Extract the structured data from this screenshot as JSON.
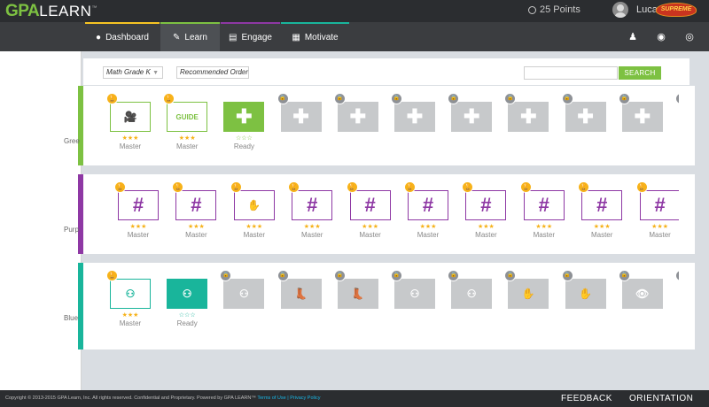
{
  "header": {
    "logo_gpa": "GPA",
    "logo_learn": "LEARN",
    "logo_tm": "™",
    "points": "25 Points",
    "username": "Lucas",
    "badge_text": "SUPREME"
  },
  "nav": {
    "tabs": [
      {
        "label": "Dashboard",
        "icon": "person-icon",
        "accent": "#f6c423"
      },
      {
        "label": "Learn",
        "icon": "pencil-icon",
        "accent": "#7dc142"
      },
      {
        "label": "Engage",
        "icon": "chat-icon",
        "accent": "#8e38a4"
      },
      {
        "label": "Motivate",
        "icon": "grid-icon",
        "accent": "#19b59b"
      }
    ],
    "right_icons": [
      "users-icon",
      "chat-bubble-icon",
      "globe-icon"
    ]
  },
  "filters": {
    "grade": "Math Grade K",
    "order": "Recommended Order",
    "search_placeholder": "",
    "search_label": "SEARCH"
  },
  "rows": [
    {
      "label": "Gree",
      "color": "#7dc142",
      "tiles": [
        {
          "glyph": "🎥",
          "style": "outline-green",
          "badge": "trophy",
          "stars": "★★★",
          "status": "Master"
        },
        {
          "glyph": "GUIDE",
          "style": "outline-green",
          "badge": "trophy",
          "stars": "★★★",
          "status": "Master"
        },
        {
          "glyph": "✚",
          "style": "solid-green",
          "badge": "none",
          "stars": "☆☆☆",
          "status": "Ready"
        },
        {
          "glyph": "✚",
          "style": "locked",
          "badge": "lock",
          "stars": "",
          "status": ""
        },
        {
          "glyph": "✚",
          "style": "locked",
          "badge": "lock",
          "stars": "",
          "status": ""
        },
        {
          "glyph": "✚",
          "style": "locked",
          "badge": "lock",
          "stars": "",
          "status": ""
        },
        {
          "glyph": "✚",
          "style": "locked",
          "badge": "lock",
          "stars": "",
          "status": ""
        },
        {
          "glyph": "✚",
          "style": "locked",
          "badge": "lock",
          "stars": "",
          "status": ""
        },
        {
          "glyph": "✚",
          "style": "locked",
          "badge": "lock",
          "stars": "",
          "status": ""
        },
        {
          "glyph": "✚",
          "style": "locked",
          "badge": "lock",
          "stars": "",
          "status": ""
        },
        {
          "glyph": "✚",
          "style": "locked",
          "badge": "lock",
          "stars": "",
          "status": ""
        }
      ]
    },
    {
      "label": "Purp",
      "color": "#8e38a4",
      "tiles": [
        {
          "glyph": "#",
          "style": "outline-purple",
          "badge": "trophy",
          "stars": "★★★",
          "status": "Master"
        },
        {
          "glyph": "#",
          "style": "outline-purple",
          "badge": "trophy",
          "stars": "★★★",
          "status": "Master"
        },
        {
          "glyph": "✋",
          "style": "outline-purple",
          "badge": "trophy",
          "stars": "★★★",
          "status": "Master"
        },
        {
          "glyph": "#",
          "style": "outline-purple",
          "badge": "trophy",
          "stars": "★★★",
          "status": "Master"
        },
        {
          "glyph": "#",
          "style": "outline-purple",
          "badge": "trophy",
          "stars": "★★★",
          "status": "Master"
        },
        {
          "glyph": "#",
          "style": "outline-purple",
          "badge": "trophy",
          "stars": "★★★",
          "status": "Master"
        },
        {
          "glyph": "#",
          "style": "outline-purple",
          "badge": "trophy",
          "stars": "★★★",
          "status": "Master"
        },
        {
          "glyph": "#",
          "style": "outline-purple",
          "badge": "trophy",
          "stars": "★★★",
          "status": "Master"
        },
        {
          "glyph": "#",
          "style": "outline-purple",
          "badge": "trophy",
          "stars": "★★★",
          "status": "Master"
        },
        {
          "glyph": "#",
          "style": "outline-purple",
          "badge": "trophy",
          "stars": "★★★",
          "status": "Master"
        }
      ]
    },
    {
      "label": "Blue",
      "color": "#19b59b",
      "tiles": [
        {
          "glyph": "⚇",
          "style": "outline-teal",
          "badge": "trophy",
          "stars": "★★★",
          "status": "Master"
        },
        {
          "glyph": "⚇",
          "style": "solid-teal",
          "badge": "none",
          "stars": "☆☆☆",
          "status": "Ready"
        },
        {
          "glyph": "⚇",
          "style": "locked",
          "badge": "lock",
          "stars": "",
          "status": ""
        },
        {
          "glyph": "👢",
          "style": "locked",
          "badge": "lock",
          "stars": "",
          "status": ""
        },
        {
          "glyph": "👢",
          "style": "locked",
          "badge": "lock",
          "stars": "",
          "status": ""
        },
        {
          "glyph": "⚇",
          "style": "locked",
          "badge": "lock",
          "stars": "",
          "status": ""
        },
        {
          "glyph": "⚇",
          "style": "locked",
          "badge": "lock",
          "stars": "",
          "status": ""
        },
        {
          "glyph": "✋",
          "style": "locked",
          "badge": "lock",
          "stars": "",
          "status": ""
        },
        {
          "glyph": "✋",
          "style": "locked",
          "badge": "lock",
          "stars": "",
          "status": ""
        },
        {
          "glyph": "👁",
          "style": "locked",
          "badge": "lock",
          "stars": "",
          "status": ""
        },
        {
          "glyph": "👁",
          "style": "locked",
          "badge": "lock",
          "stars": "",
          "status": ""
        }
      ]
    }
  ],
  "footer": {
    "copyright": "Copyright © 2013-2015 GPA Learn, Inc. All rights reserved. Confidential and Proprietary.   Powered by GPA LEARN™",
    "terms": "Terms of Use",
    "separator": "|",
    "privacy": "Privacy Policy",
    "feedback": "FEEDBACK",
    "orientation": "ORIENTATION"
  }
}
